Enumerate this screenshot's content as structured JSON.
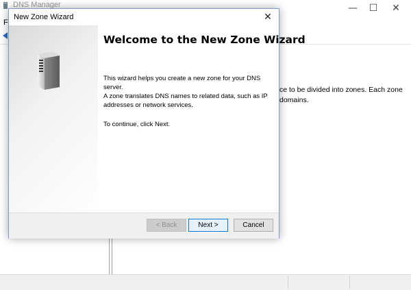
{
  "background_window": {
    "title": "DNS Manager",
    "menu_first_item": "F",
    "controls": {
      "minimize": "—",
      "maximize": "☐",
      "close": "✕"
    },
    "right_pane_text": "ce to be divided into zones. Each zone domains."
  },
  "wizard": {
    "title": "New Zone Wizard",
    "close_glyph": "✕",
    "heading": "Welcome to the New Zone Wizard",
    "paragraphs": [
      "This wizard helps you create a new zone for your DNS server.",
      "A zone translates DNS names to related data, such as IP addresses or network services.",
      "To continue, click Next."
    ],
    "buttons": {
      "back": "< Back",
      "next": "Next >",
      "cancel": "Cancel"
    },
    "icon": "server-icon"
  },
  "colors": {
    "accent": "#0078d7",
    "dialog_border": "#7a9ad6"
  }
}
